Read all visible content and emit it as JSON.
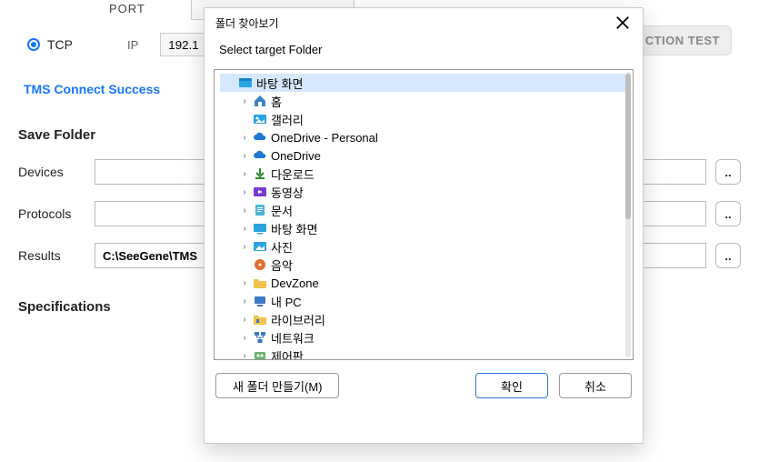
{
  "bg": {
    "port_label": "PORT",
    "tcp_label": "TCP",
    "ip_label": "IP",
    "ip_value": "192.1",
    "action_test": "CTION TEST",
    "success": "TMS Connect Success",
    "save_folder_title": "Save Folder",
    "fields": {
      "devices_label": "Devices",
      "protocols_label": "Protocols",
      "results_label": "Results",
      "results_value": "C:\\SeeGene\\TMS"
    },
    "spec_title": "Specifications"
  },
  "dialog": {
    "title": "폴더 찾아보기",
    "subtitle": "Select target Folder",
    "new_folder_label": "새 폴더 만들기(M)",
    "ok_label": "확인",
    "cancel_label": "취소",
    "selected_root": "바탕 화면",
    "items": [
      {
        "label": "홈",
        "icon": "home"
      },
      {
        "label": "갤러리",
        "icon": "gallery"
      },
      {
        "label": "OneDrive - Personal",
        "icon": "cloud"
      },
      {
        "label": "OneDrive",
        "icon": "cloud"
      },
      {
        "label": "다운로드",
        "icon": "download"
      },
      {
        "label": "동영상",
        "icon": "video"
      },
      {
        "label": "문서",
        "icon": "doc"
      },
      {
        "label": "바탕 화면",
        "icon": "desktop"
      },
      {
        "label": "사진",
        "icon": "picture"
      },
      {
        "label": "음악",
        "icon": "music"
      },
      {
        "label": "DevZone",
        "icon": "folder"
      },
      {
        "label": "내 PC",
        "icon": "pc"
      },
      {
        "label": "라이브러리",
        "icon": "library"
      },
      {
        "label": "네트워크",
        "icon": "network"
      },
      {
        "label": "제어판",
        "icon": "control"
      }
    ]
  }
}
